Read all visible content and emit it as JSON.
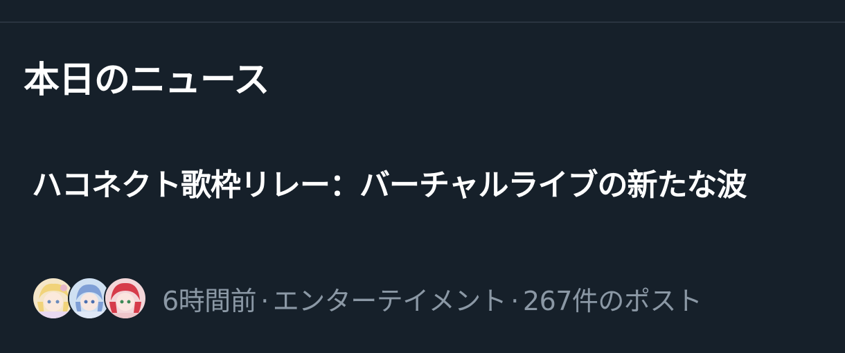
{
  "section": {
    "title": "本日のニュース"
  },
  "news": {
    "headline": "ハコネクト歌枠リレー：バーチャルライブの新たな波",
    "time": "6時間前",
    "category": "エンターテイメント",
    "post_count": "267件のポスト",
    "separator": "·"
  },
  "colors": {
    "background": "#16202a",
    "headline": "#ffffff",
    "meta": "#8b98a5",
    "divider": "#2a3440"
  },
  "icons": {
    "avatars": [
      "avatar-blonde-character",
      "avatar-blue-hair-character",
      "avatar-red-hair-character"
    ]
  }
}
